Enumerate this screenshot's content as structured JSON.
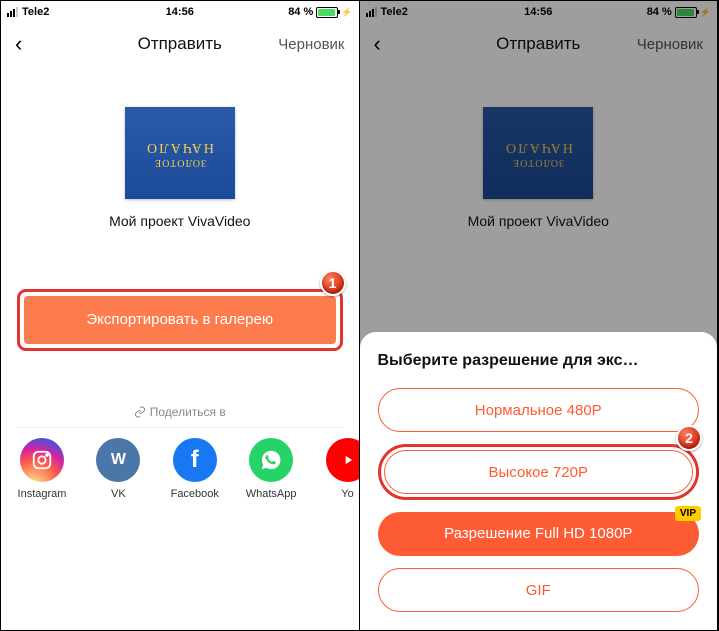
{
  "statusbar": {
    "carrier": "Tele2",
    "time": "14:56",
    "battery_pct": "84 %"
  },
  "header": {
    "title": "Отправить",
    "draft": "Черновик"
  },
  "project": {
    "name": "Мой проект VivaVideo"
  },
  "export": {
    "button": "Экспортировать в галерею"
  },
  "share": {
    "label": "Поделиться в",
    "items": [
      {
        "name": "Instagram"
      },
      {
        "name": "VK"
      },
      {
        "name": "Facebook"
      },
      {
        "name": "WhatsApp"
      },
      {
        "name": "Yo"
      }
    ]
  },
  "sheet": {
    "title": "Выберите разрешение для экс…",
    "opt_480": "Нормальное 480P",
    "opt_720": "Высокое 720P",
    "opt_1080": "Разрешение Full HD 1080P",
    "opt_gif": "GIF",
    "vip": "VIP"
  },
  "annotations": {
    "step1": "1",
    "step2": "2"
  }
}
